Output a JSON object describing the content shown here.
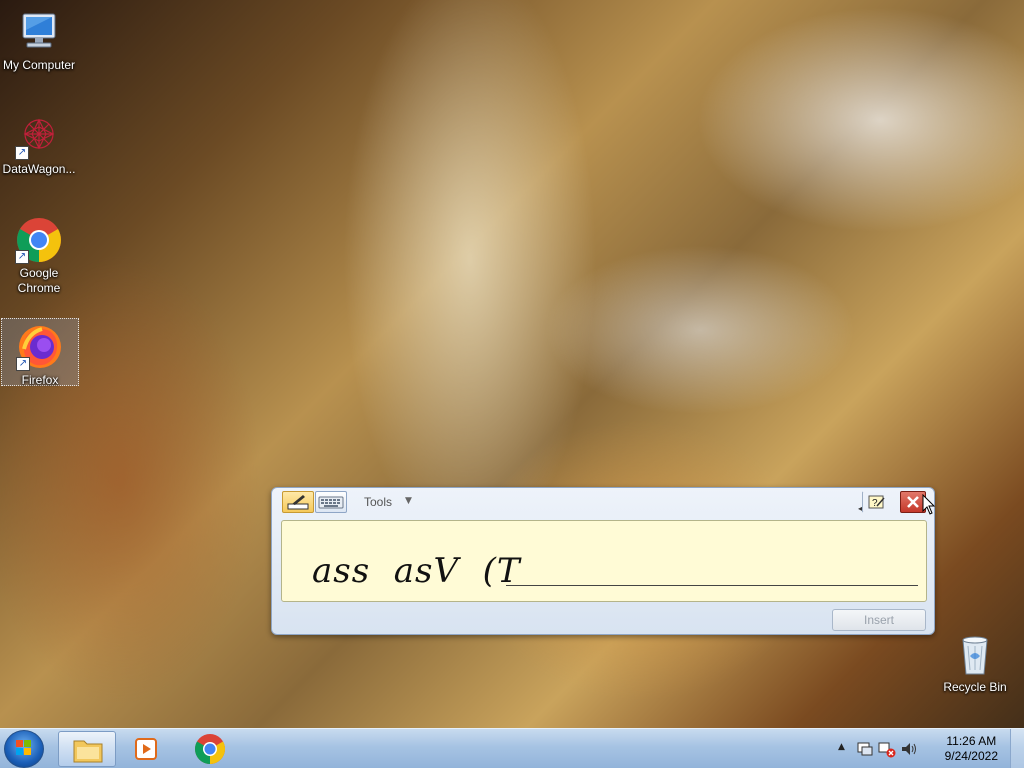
{
  "desktop": {
    "icons": [
      {
        "label": "My Computer"
      },
      {
        "label": "DataWagon..."
      },
      {
        "label": "Google Chrome"
      },
      {
        "label": "Firefox"
      },
      {
        "label": "Recycle Bin"
      }
    ]
  },
  "input_panel": {
    "tools_label": "Tools",
    "ink_text": "ass  asV  (T",
    "insert_label": "Insert"
  },
  "taskbar": {
    "pinned": [
      "windows-explorer",
      "media-player",
      "google-chrome"
    ],
    "clock": {
      "time": "11:26 AM",
      "date": "9/24/2022"
    }
  },
  "colors": {
    "taskbar": "#a6c3e3",
    "writing_area": "#fffbd6",
    "close_button": "#c4382a"
  }
}
